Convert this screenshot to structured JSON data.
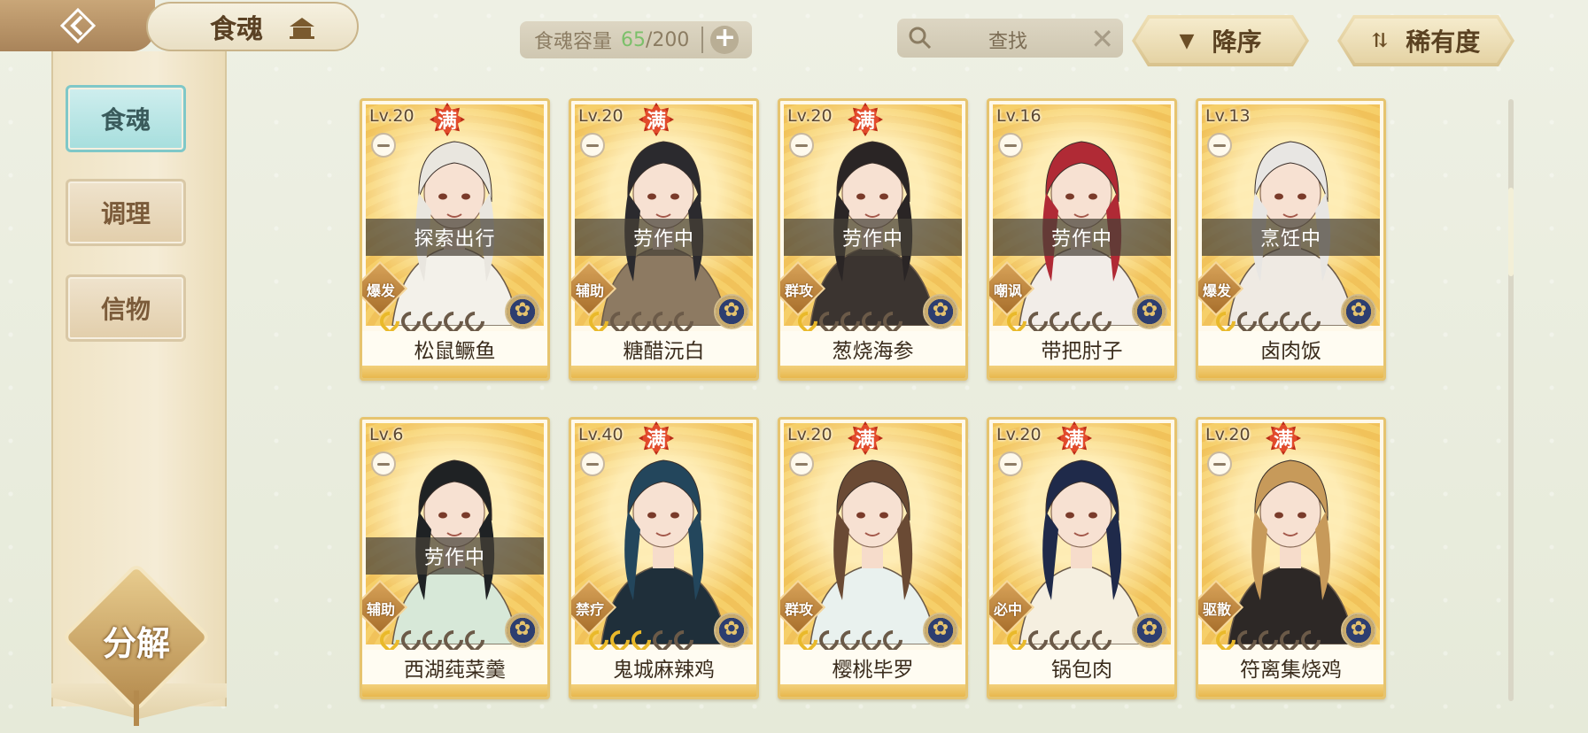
{
  "header": {
    "title": "食魂",
    "capacity_label": "食魂容量",
    "capacity_current": "65",
    "capacity_max": "/200",
    "capacity_add": "+",
    "search_placeholder": "查找",
    "search_clear": "✕",
    "sort_order_label": "降序",
    "sort_field_label": "稀有度"
  },
  "sidebar": {
    "items": [
      {
        "label": "食魂",
        "active": true
      },
      {
        "label": "调理",
        "active": false
      },
      {
        "label": "信物",
        "active": false
      }
    ],
    "decompose_label": "分解"
  },
  "cards": [
    {
      "level": "Lv.20",
      "full": "满",
      "status": "探索出行",
      "role": "爆发",
      "stars": 1,
      "name": "松鼠鳜鱼",
      "hair": "#e9e6df",
      "outfit": "#f3f1ea"
    },
    {
      "level": "Lv.20",
      "full": "满",
      "status": "劳作中",
      "role": "辅助",
      "stars": 1,
      "name": "糖醋沅白",
      "hair": "#2b2a2e",
      "outfit": "#8d7a62"
    },
    {
      "level": "Lv.20",
      "full": "满",
      "status": "劳作中",
      "role": "群攻",
      "stars": 1,
      "name": "葱烧海参",
      "hair": "#2a2525",
      "outfit": "#3b3430"
    },
    {
      "level": "Lv.16",
      "full": "",
      "status": "劳作中",
      "role": "嘲讽",
      "stars": 1,
      "name": "带把肘子",
      "hair": "#b02a35",
      "outfit": "#f2ede8"
    },
    {
      "level": "Lv.13",
      "full": "",
      "status": "烹饪中",
      "role": "爆发",
      "stars": 1,
      "name": "卤肉饭",
      "hair": "#e8e6e3",
      "outfit": "#efeae3"
    },
    {
      "level": "Lv.6",
      "full": "",
      "status": "劳作中",
      "role": "辅助",
      "stars": 1,
      "name": "西湖莼菜羹",
      "hair": "#1f2224",
      "outfit": "#d7e8d8"
    },
    {
      "level": "Lv.40",
      "full": "满",
      "status": "",
      "role": "禁疗",
      "stars": 3,
      "name": "鬼城麻辣鸡",
      "hair": "#23465c",
      "outfit": "#1f2f3a"
    },
    {
      "level": "Lv.20",
      "full": "满",
      "status": "",
      "role": "群攻",
      "stars": 1,
      "name": "樱桃毕罗",
      "hair": "#6a4a34",
      "outfit": "#e9f1ee"
    },
    {
      "level": "Lv.20",
      "full": "满",
      "status": "",
      "role": "必中",
      "stars": 1,
      "name": "锅包肉",
      "hair": "#1f2a4a",
      "outfit": "#f5efe0"
    },
    {
      "level": "Lv.20",
      "full": "满",
      "status": "",
      "role": "驱散",
      "stars": 1,
      "name": "符离集烧鸡",
      "hair": "#c79a5a",
      "outfit": "#2d2826"
    }
  ],
  "colors": {
    "accent_gold": "#e6c46f",
    "capacity_current": "#7bc06a",
    "full_badge": "#e14a2b",
    "active_tab": "#a6dedd"
  },
  "icons": {
    "back": "back-arrow-icon",
    "title_roof": "pavilion-icon",
    "search": "search-icon",
    "sort_order": "down-triangle-icon",
    "sort_field": "sort-arrows-icon"
  }
}
